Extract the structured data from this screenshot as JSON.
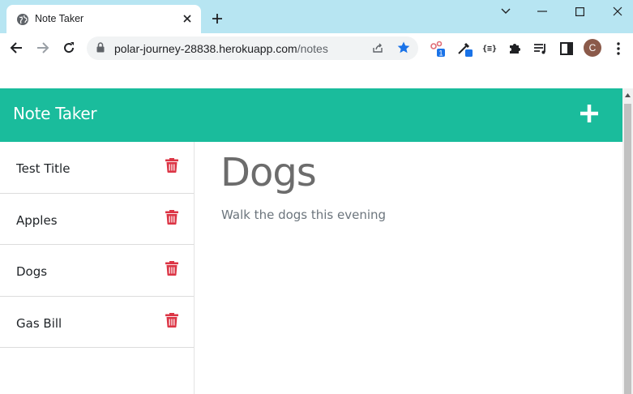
{
  "browser": {
    "tab_title": "Note Taker",
    "url_host": "polar-journey-28838.herokuapp.com",
    "url_path": "/notes",
    "profile_initial": "C",
    "extension_badge": "1",
    "extension_json_label": "{≡}"
  },
  "navbar": {
    "brand": "Note Taker",
    "accent_color": "#1abc9c"
  },
  "notes": [
    {
      "title": "Test Title"
    },
    {
      "title": "Apples"
    },
    {
      "title": "Dogs"
    },
    {
      "title": "Gas Bill"
    }
  ],
  "active_note": {
    "title": "Dogs",
    "text": "Walk the dogs this evening"
  },
  "colors": {
    "delete_icon": "#dc3545",
    "tabstrip": "#b7e5f2"
  }
}
